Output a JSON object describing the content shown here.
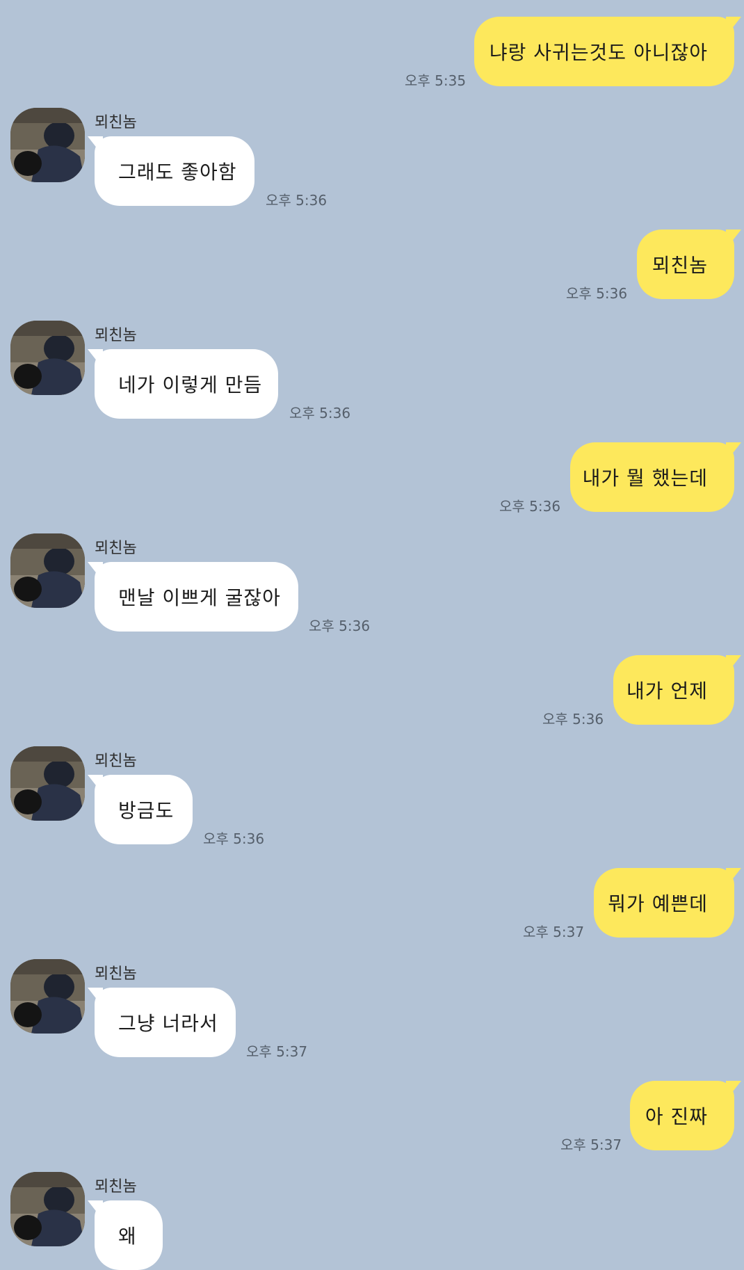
{
  "contact": {
    "name": "뫼친놈"
  },
  "colors": {
    "background": "#b3c3d6",
    "my_bubble": "#fde85c",
    "their_bubble": "#ffffff"
  },
  "messages": [
    {
      "from": "me",
      "text": "냐랑 사귀는것도 아니잖아",
      "time": "오후 5:35"
    },
    {
      "from": "them",
      "text": "그래도 좋아함",
      "time": "오후 5:36"
    },
    {
      "from": "me",
      "text": "뫼친놈",
      "time": "오후 5:36"
    },
    {
      "from": "them",
      "text": "네가 이렇게 만듬",
      "time": "오후 5:36"
    },
    {
      "from": "me",
      "text": "내가 뭘 했는데",
      "time": "오후 5:36"
    },
    {
      "from": "them",
      "text": "맨날 이쁘게 굴잖아",
      "time": "오후 5:36"
    },
    {
      "from": "me",
      "text": "내가 언제",
      "time": "오후 5:36"
    },
    {
      "from": "them",
      "text": "방금도",
      "time": "오후 5:36"
    },
    {
      "from": "me",
      "text": "뭐가 예쁜데",
      "time": "오후 5:37"
    },
    {
      "from": "them",
      "text": "그냥 너라서",
      "time": "오후 5:37"
    },
    {
      "from": "me",
      "text": "아 진짜",
      "time": "오후 5:37"
    },
    {
      "from": "them",
      "text": "왜",
      "time": ""
    }
  ]
}
